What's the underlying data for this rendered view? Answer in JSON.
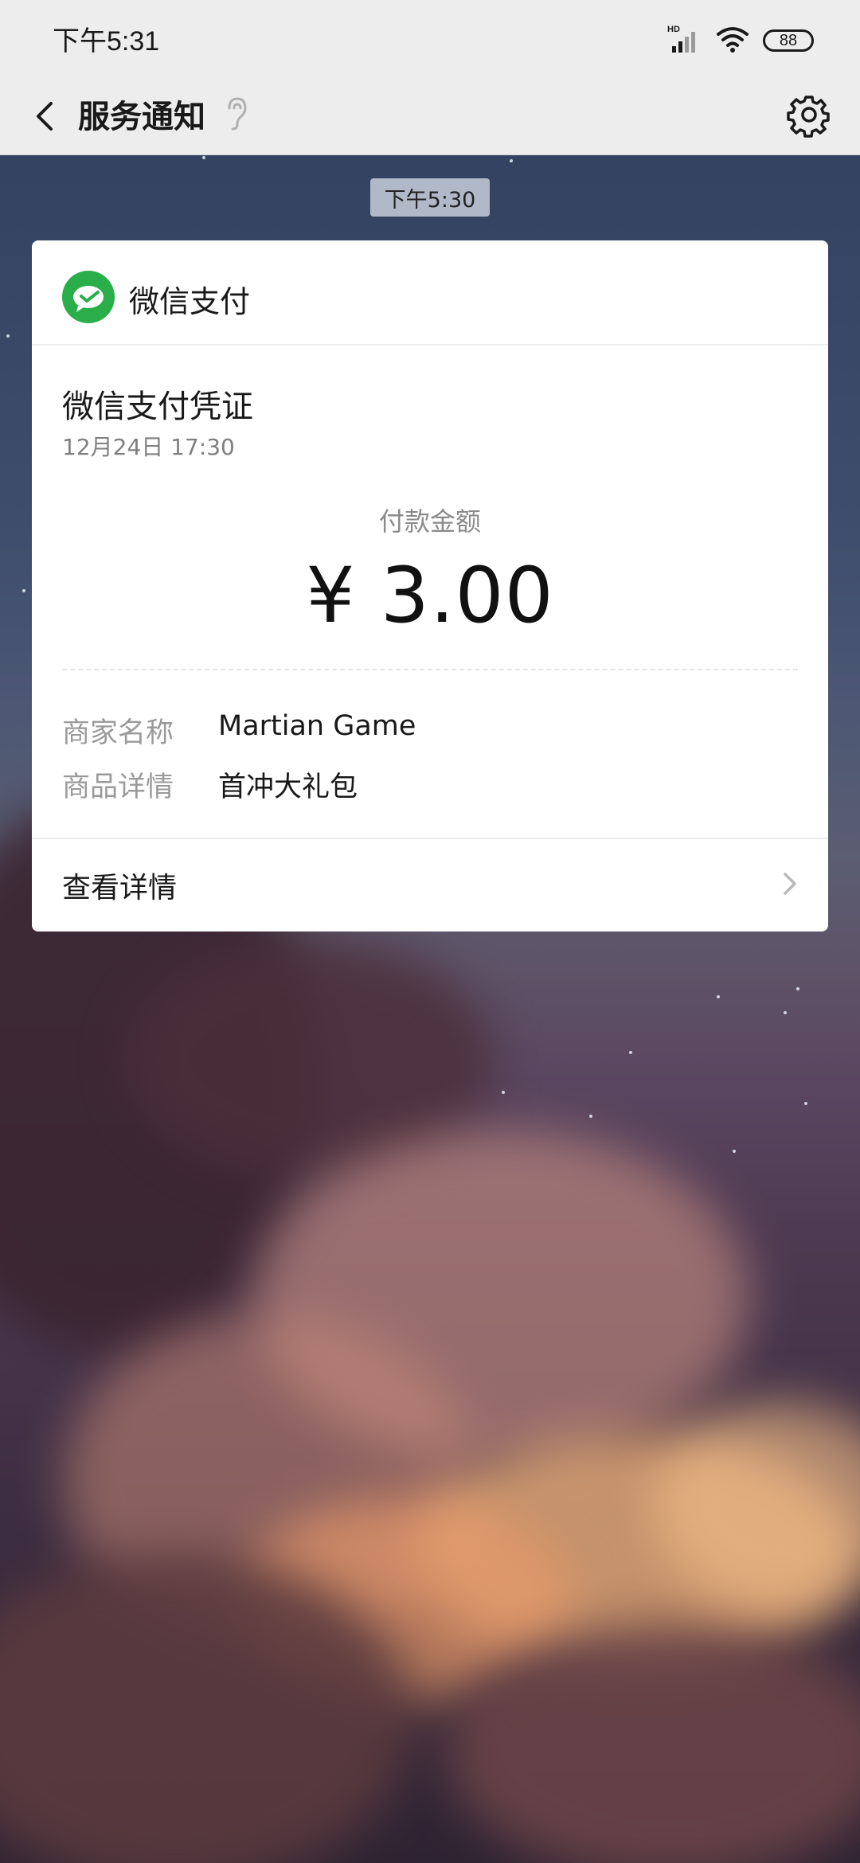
{
  "status_bar": {
    "time": "下午5:31",
    "signal_label": "HD",
    "battery": "88"
  },
  "nav": {
    "title": "服务通知",
    "back_icon": "chevron-left-icon",
    "mute_icon": "ear-icon",
    "settings_icon": "gear-icon"
  },
  "message": {
    "timestamp": "下午5:30"
  },
  "card": {
    "brand_name": "微信支付",
    "brand_color": "#2aae4a",
    "title": "微信支付凭证",
    "date": "12月24日  17:30",
    "amount_label": "付款金额",
    "amount": "¥ 3.00",
    "details": [
      {
        "key": "商家名称",
        "value": "Martian Game"
      },
      {
        "key": "商品详情",
        "value": "首冲大礼包"
      }
    ],
    "footer_label": "查看详情"
  }
}
